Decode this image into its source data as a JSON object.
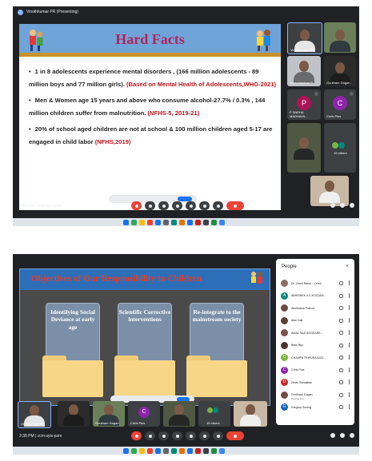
{
  "screenshot1": {
    "presenter_label": "Vinothkumar PR (Presenting)",
    "slide": {
      "title": "Hard Facts",
      "bullets": [
        {
          "text": "1 in 8 adolescents experience mental disorders , (166 million adolescents - 89 million boys and 77 million girls).",
          "source": "(Based on Mental Health of Adolescents,WHO-2021)"
        },
        {
          "text": "Men & Women age 15 years and above who consume alcohol-27.7% / 0.3% , 144 million children suffer from malnutrition.",
          "source": "(NFHS-5, 2019-21)"
        },
        {
          "text": "20% of school aged children are not at school & 100 million children aged 5-17 are engaged in child labor",
          "source": "(NFHS,2019)"
        }
      ]
    },
    "tiles": [
      {
        "name": "Vinothkumar PR"
      },
      {
        "name": ""
      },
      {
        "name": "Jayachandran P"
      },
      {
        "name": "Goutham Gagan"
      },
      {
        "name": "P SNEHA MADHAVA...",
        "initial": "P"
      },
      {
        "name": "Chris Pius",
        "initial": "C"
      },
      {
        "name": "15 others"
      },
      {
        "name": ""
      }
    ],
    "meeting": "2:36 PM | zcm-syix-pzm"
  },
  "screenshot2": {
    "slide": {
      "title": "Objectives of Our Responsibility to Children",
      "folders": [
        "Identifying Social Deviance at early age",
        "Scientific Corrective interventions",
        "Re-integrate to the mainstream society"
      ]
    },
    "people_panel": {
      "title": "People",
      "close": "×",
      "participants": [
        {
          "name": "Dr. Vinod Rahm... (You)",
          "initial": "",
          "color": "#8d6e63"
        },
        {
          "name": "ABHISHEK A S KOZZAM...",
          "initial": "A",
          "color": "#00897b"
        },
        {
          "name": "Akshwana Prahod",
          "initial": "",
          "color": "#6d4c41"
        },
        {
          "name": "Alan Saji",
          "initial": "",
          "color": "#5d4037"
        },
        {
          "name": "AMAL SAJI AGGEARE...",
          "initial": "",
          "color": "#795548"
        },
        {
          "name": "Bibin Biju",
          "initial": "",
          "color": "#4e342e"
        },
        {
          "name": "CHAMPA TRIPURA AGG...",
          "initial": "C",
          "color": "#7cb342"
        },
        {
          "name": "Chris Pius",
          "initial": "C",
          "color": "#8e24aa"
        },
        {
          "name": "Devin Sebastian",
          "initial": "D",
          "color": "#c62828"
        },
        {
          "name": "Goutham Gagan",
          "sub": "Meeting host",
          "initial": "",
          "color": "#6d4c41"
        },
        {
          "name": "Gregory Sonnig",
          "initial": "G",
          "color": "#1565c0"
        }
      ]
    },
    "tiles": [
      {
        "name": "Vinothkumar PR"
      },
      {
        "name": ""
      },
      {
        "name": "Goutham Gagan"
      },
      {
        "name": "Chris Pius",
        "initial": "C"
      },
      {
        "name": ""
      },
      {
        "name": "15 others"
      },
      {
        "name": ""
      }
    ],
    "meeting": "2:38 PM | zcm-syix-pzm"
  },
  "colors": {
    "meet_bg": "#202124",
    "tile_bg": "#3c4043",
    "leave": "#ea4335",
    "title_red": "#b1245c",
    "accent_blue": "#1a73e8"
  }
}
